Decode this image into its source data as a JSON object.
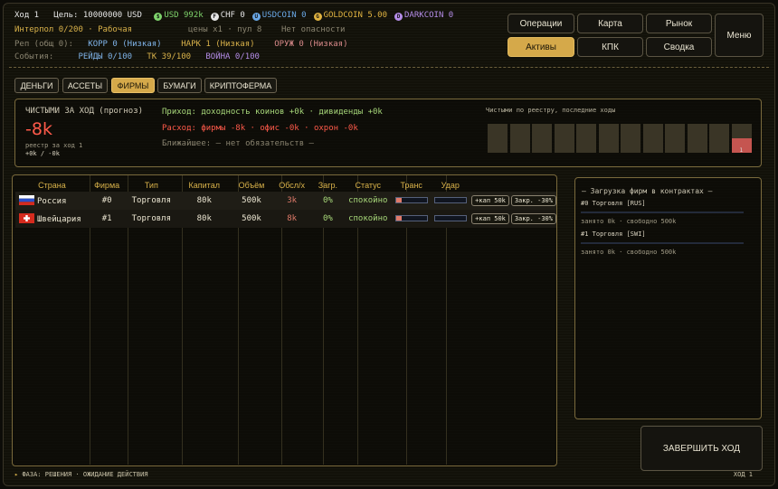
{
  "header": {
    "turn": "Ход 1",
    "goal_label": "Цель:",
    "goal_value": "10000000 USD",
    "currencies": [
      {
        "glyph": "$",
        "label": "USD 992k",
        "color": "#7fd46c"
      },
      {
        "glyph": "F",
        "label": "CHF 0",
        "color": "#e6e6e6"
      },
      {
        "glyph": "U",
        "label": "USDCOIN 0",
        "color": "#6aa8e6"
      },
      {
        "glyph": "G",
        "label": "GOLDCOIN 5.00",
        "color": "#e0b341"
      },
      {
        "glyph": "D",
        "label": "DARKCOIN 0",
        "color": "#b58de8"
      }
    ],
    "interpol": "Интерпол 0/200 · Рабочая",
    "prices": "цены x1 · пул 8",
    "danger": "Нет опасности",
    "rep_label": "Реп (общ 0):",
    "rep_korr": "КОРР 0 (Низкая)",
    "rep_nark": "НАРК 1 (Низкая)",
    "rep_oruzh": "ОРУЖ 0 (Низкая)",
    "events_label": "События:",
    "events_raids": "РЕЙДЫ 0/100",
    "events_tk": "ТК 39/100",
    "events_war": "ВОЙНА 0/100"
  },
  "nav": {
    "operations": "Операции",
    "map": "Карта",
    "market": "Рынок",
    "menu": "Меню",
    "assets": "Активы",
    "kpk": "КПК",
    "summary": "Сводка"
  },
  "tabs": [
    "ДЕНЬГИ",
    "АССЕТЫ",
    "ФИРМЫ",
    "БУМАГИ",
    "КРИПТОФЕРМА"
  ],
  "active_tab": "ФИРМЫ",
  "summary": {
    "title": "ЧИСТЫМИ ЗА ХОД (прогноз)",
    "value": "-8k",
    "reestr": "реестр за ход 1",
    "reestr_val": "+0k / -0k",
    "income": "Приход: доходность коинов +0k · дивиденды +0k",
    "expense": "Расход: фирмы -8k · офис -0k · охрон -0k",
    "nearest": "Ближайшее: — нет обязательств —",
    "chart_title": "Чистыми по реестру, последние ходы",
    "chart_last_label": "1"
  },
  "chart_data": {
    "type": "bar",
    "title": "Чистыми по реестру, последние ходы",
    "categories": [
      "",
      "",
      "",
      "",
      "",
      "",
      "",
      "",
      "",
      "",
      "",
      "1"
    ],
    "values": [
      0,
      0,
      0,
      0,
      0,
      0,
      0,
      0,
      0,
      0,
      0,
      -8
    ],
    "units": "k"
  },
  "firms": {
    "columns": [
      "Страна",
      "Фирма",
      "Тип",
      "Капитал",
      "Объём",
      "Обсл/х",
      "Загр.",
      "Статус",
      "Транс",
      "Удар",
      "",
      ""
    ],
    "rows": [
      {
        "flag": "ru",
        "country": "Россия",
        "firm": "#0",
        "type": "Торговля",
        "capital": "80k",
        "volume": "500k",
        "service": "3k",
        "load": "0%",
        "status": "спокойно",
        "trans": 0.2,
        "udar": 0.0,
        "btn_cap": "+кап 50k",
        "btn_close": "Закр. -30%"
      },
      {
        "flag": "ch",
        "country": "Швейцария",
        "firm": "#1",
        "type": "Торговля",
        "capital": "80k",
        "volume": "500k",
        "service": "8k",
        "load": "0%",
        "status": "спокойно",
        "trans": 0.2,
        "udar": 0.0,
        "btn_cap": "+кап 50k",
        "btn_close": "Закр. -30%"
      }
    ]
  },
  "side": {
    "title": "— Загрузка фирм в контрактах —",
    "items": [
      {
        "name": "#0 Торговля [RUS]",
        "info": "занято 0k · свободно 500k"
      },
      {
        "name": "#1 Торговля [SWI]",
        "info": "занято 0k · свободно 500k"
      }
    ]
  },
  "end_turn": "ЗАВЕРШИТЬ ХОД",
  "footer": {
    "phase": "ФАЗА: РЕШЕНИЯ · ОЖИДАНИЕ ДЕЙСТВИЯ",
    "turn": "ХОД 1"
  }
}
